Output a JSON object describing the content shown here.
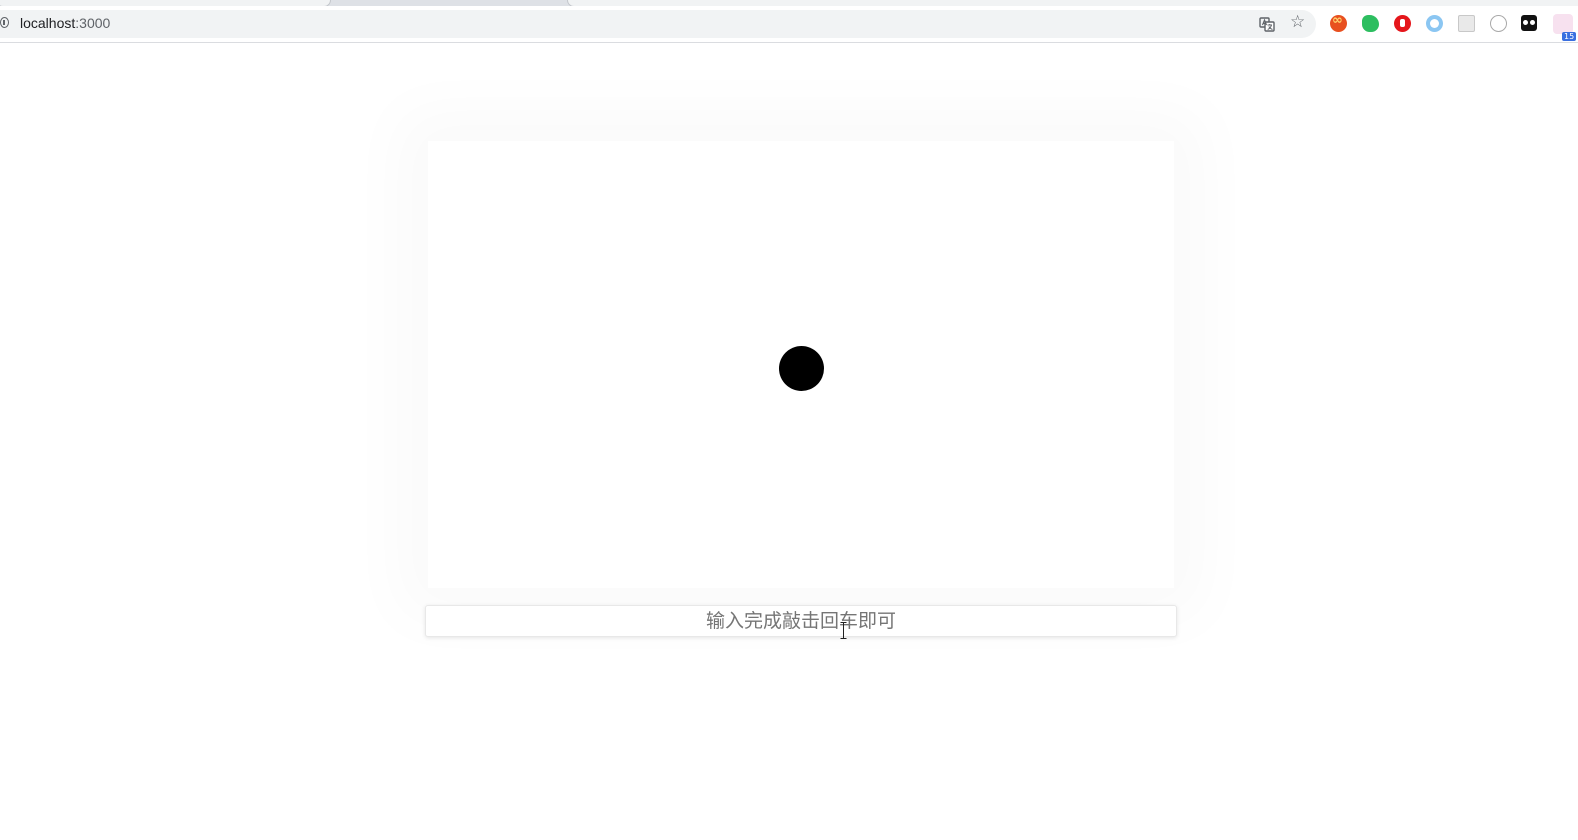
{
  "browser": {
    "url_host": "localhost",
    "url_port": ":3000",
    "toolbar_icons": [
      "translate-icon",
      "star-icon"
    ],
    "extensions": [
      "infinity-extension-icon",
      "evernote-icon",
      "adblock-icon",
      "circle-extension-icon",
      "grid-extension-icon",
      "clock-extension-icon",
      "tampermonkey-icon",
      "calendar-extension-icon"
    ],
    "extension_badge": "15"
  },
  "page": {
    "input_placeholder": "输入完成敲击回车即可"
  }
}
